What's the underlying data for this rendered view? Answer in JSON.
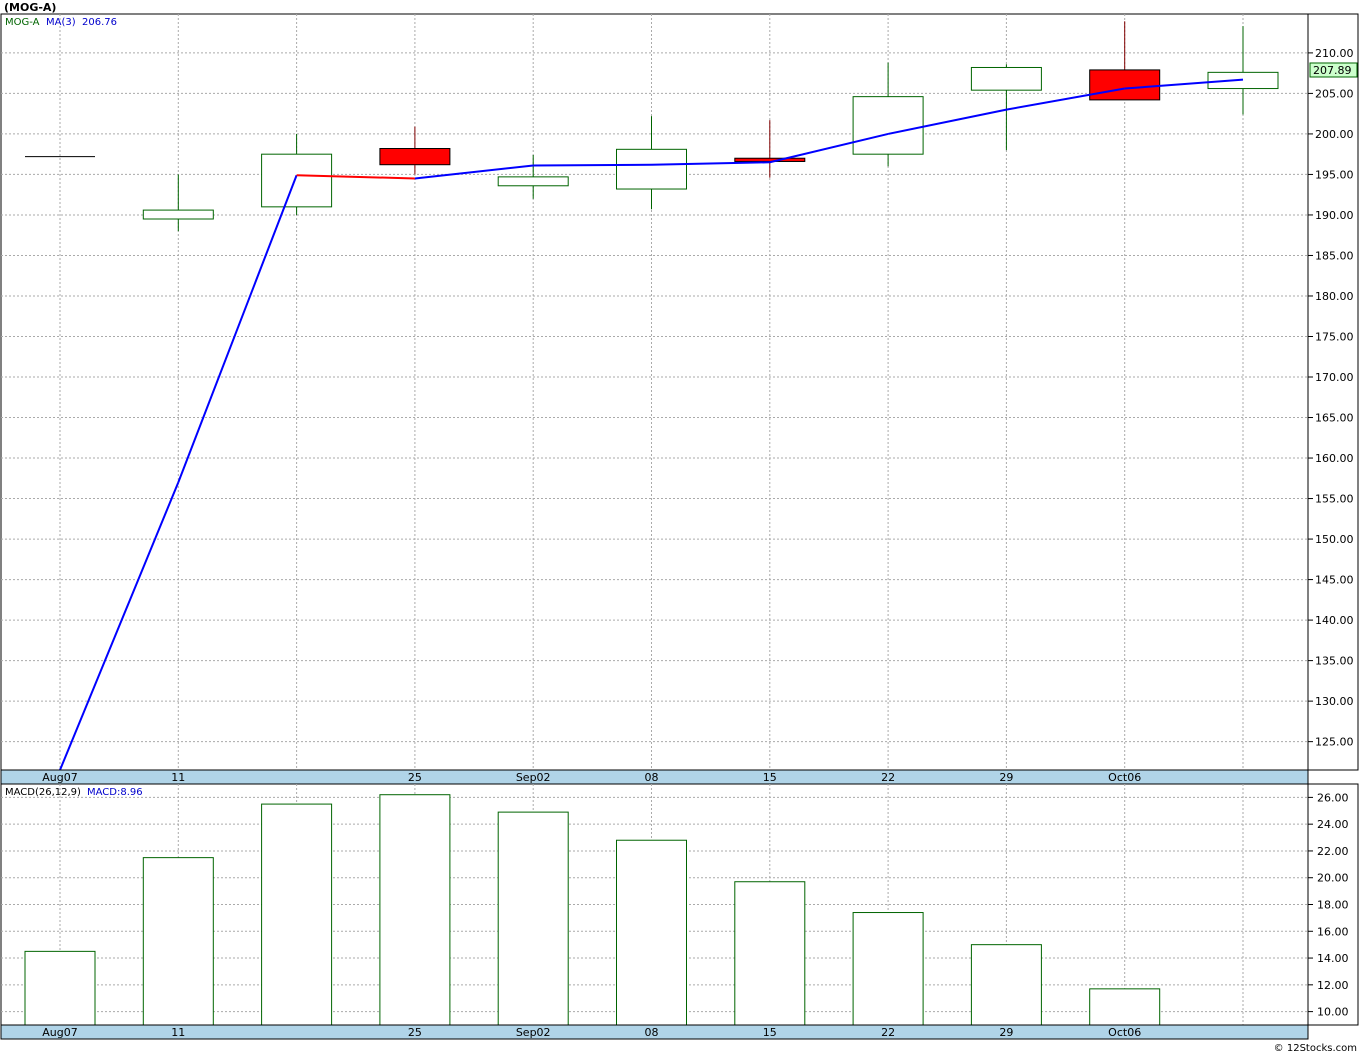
{
  "header": {
    "symbol_title": "(MOG-A)",
    "price_legend": "MOG-A",
    "ma_label": "MA(3)",
    "ma_value": "206.76",
    "macd_label": "MACD(26,12,9)",
    "macd_value": "MACD:8.96",
    "last_price": "207.89",
    "copyright": "© 12Stocks.com"
  },
  "colors": {
    "up_candle": "#006400",
    "down_candle_fill": "#ff0000",
    "ma_line": "#0000ff",
    "ma_down_segment": "#ff0000",
    "macd_bar": "#006400",
    "axis_band": "#b0d4e8",
    "last_price_bg": "#ccffcc"
  },
  "chart_data": [
    {
      "type": "candlestick",
      "title": "(MOG-A)",
      "x_labels": [
        "Aug07",
        "11",
        "",
        "25",
        "Sep02",
        "08",
        "15",
        "22",
        "29",
        "Oct06",
        ""
      ],
      "ylim": [
        121.5,
        214.8
      ],
      "y_ticks": [
        "125.00",
        "130.00",
        "135.00",
        "140.00",
        "145.00",
        "150.00",
        "155.00",
        "160.00",
        "165.00",
        "170.00",
        "175.00",
        "180.00",
        "185.00",
        "190.00",
        "195.00",
        "200.00",
        "205.00",
        "210.00"
      ],
      "grid": true,
      "candles": [
        {
          "open": 197.2,
          "high": 197.2,
          "low": 197.2,
          "close": 197.2,
          "dir": "up"
        },
        {
          "open": 189.5,
          "high": 195.0,
          "low": 188.0,
          "close": 190.6,
          "dir": "up"
        },
        {
          "open": 191.0,
          "high": 200.0,
          "low": 190.0,
          "close": 197.5,
          "dir": "up"
        },
        {
          "open": 198.2,
          "high": 200.9,
          "low": 195.0,
          "close": 196.2,
          "dir": "down"
        },
        {
          "open": 193.6,
          "high": 197.4,
          "low": 192.0,
          "close": 194.7,
          "dir": "up"
        },
        {
          "open": 193.2,
          "high": 202.2,
          "low": 190.7,
          "close": 198.1,
          "dir": "up"
        },
        {
          "open": 197.0,
          "high": 201.7,
          "low": 194.6,
          "close": 196.6,
          "dir": "down"
        },
        {
          "open": 197.5,
          "high": 208.8,
          "low": 196.0,
          "close": 204.6,
          "dir": "up"
        },
        {
          "open": 205.4,
          "high": 208.6,
          "low": 198.0,
          "close": 208.2,
          "dir": "up"
        },
        {
          "open": 207.9,
          "high": 213.9,
          "low": 204.3,
          "close": 204.2,
          "dir": "down"
        },
        {
          "open": 205.6,
          "high": 213.3,
          "low": 202.4,
          "close": 207.6,
          "dir": "up"
        }
      ],
      "series": [
        {
          "name": "MA(3)",
          "values": [
            121.5,
            157.0,
            194.9,
            194.5,
            196.1,
            196.2,
            196.5,
            200.0,
            203.0,
            205.6,
            206.7
          ]
        }
      ],
      "last_value": 207.89
    },
    {
      "type": "bar",
      "title": "MACD(26,12,9)",
      "x_labels": [
        "Aug07",
        "11",
        "",
        "25",
        "Sep02",
        "08",
        "15",
        "22",
        "29",
        "Oct06",
        ""
      ],
      "values": [
        14.5,
        21.5,
        25.5,
        26.2,
        24.9,
        22.8,
        19.7,
        17.4,
        15.0,
        11.7,
        8.96
      ],
      "ylim": [
        9.0,
        27.0
      ],
      "y_ticks": [
        "10.00",
        "12.00",
        "14.00",
        "16.00",
        "18.00",
        "20.00",
        "22.00",
        "24.00",
        "26.00"
      ],
      "grid": true
    }
  ]
}
